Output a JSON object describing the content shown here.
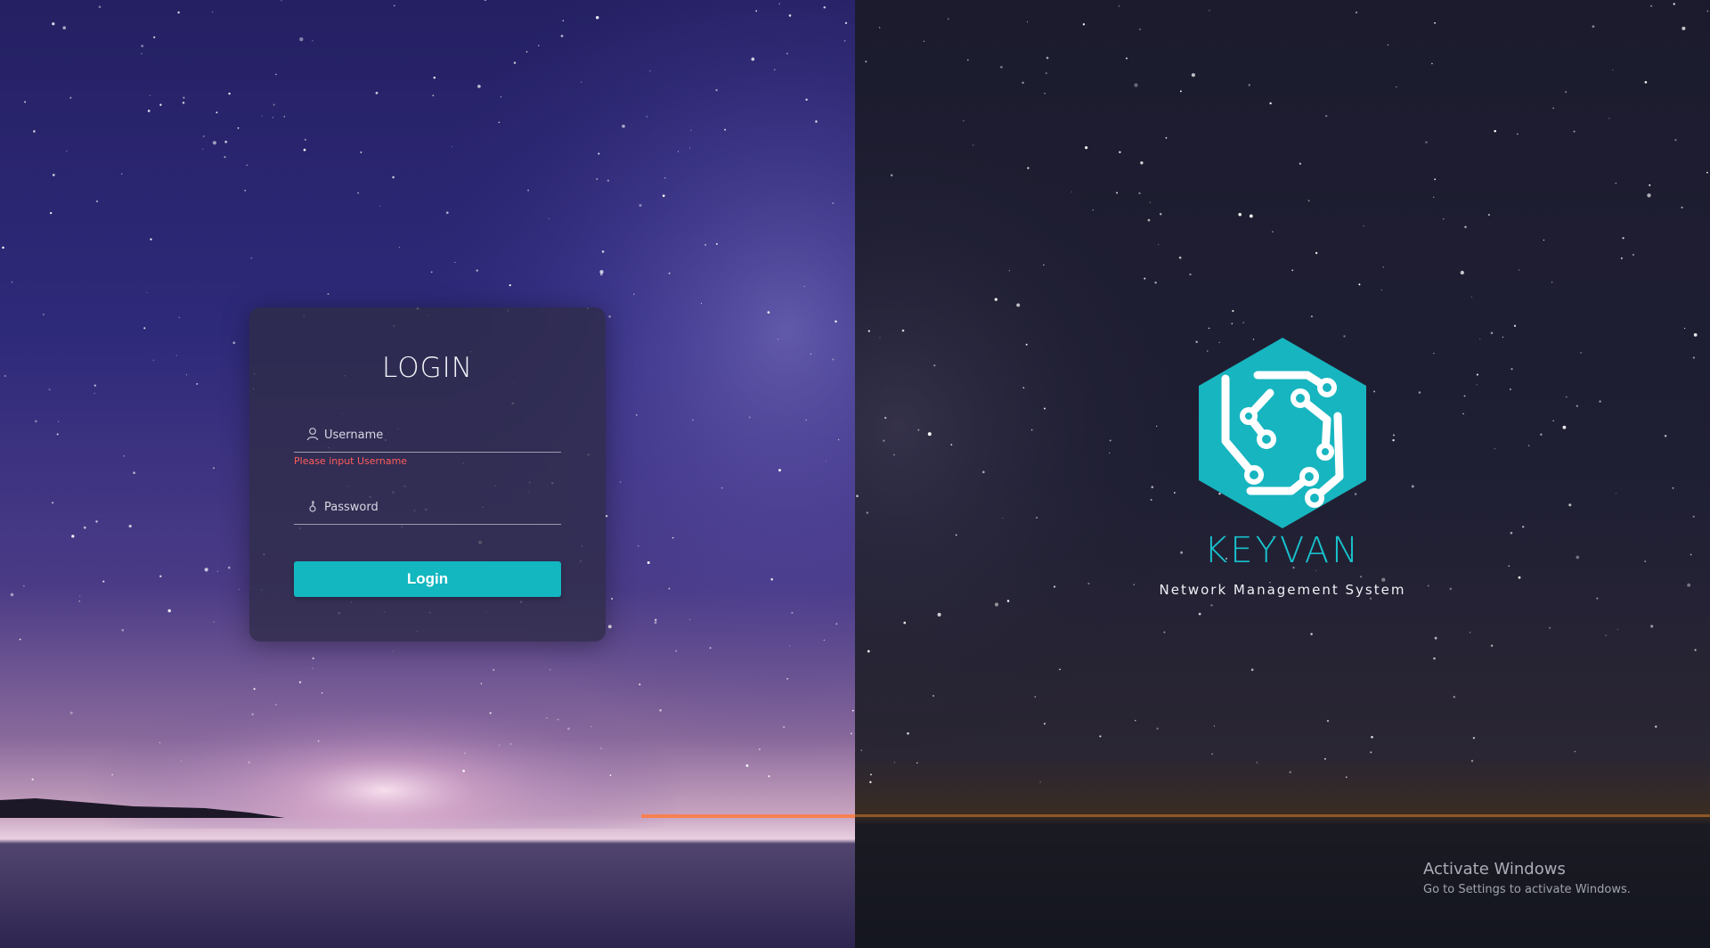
{
  "login": {
    "title": "LOGIN",
    "username": {
      "placeholder": "Username",
      "value": "",
      "error": "Please input Username"
    },
    "password": {
      "placeholder": "Password",
      "value": ""
    },
    "submit_label": "Login"
  },
  "brand": {
    "name": "KEYVAN",
    "tagline": "Network Management System"
  },
  "watermark": {
    "title": "Activate Windows",
    "subtitle": "Go to Settings to activate Windows."
  },
  "colors": {
    "accent": "#13b7c0",
    "error": "#ff5d5d",
    "card": "#2e2c46"
  }
}
